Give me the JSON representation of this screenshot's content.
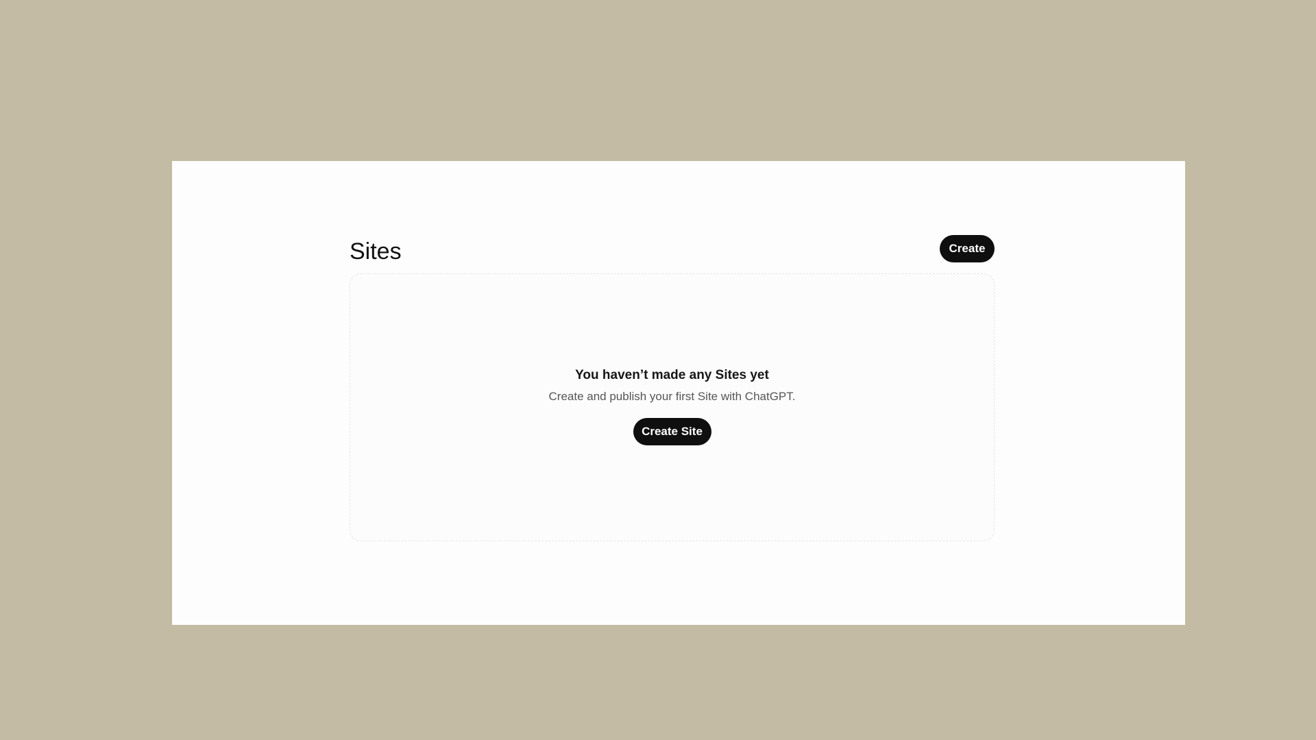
{
  "page": {
    "title": "Sites",
    "create_label": "Create"
  },
  "empty_state": {
    "title": "You haven’t made any Sites yet",
    "subtitle": "Create and publish your first Site with ChatGPT.",
    "button_label": "Create Site"
  },
  "colors": {
    "backdrop": "#c4bba5",
    "window": "#fdfdfd",
    "button": "#0f0f0f",
    "button_text": "#ffffff"
  }
}
